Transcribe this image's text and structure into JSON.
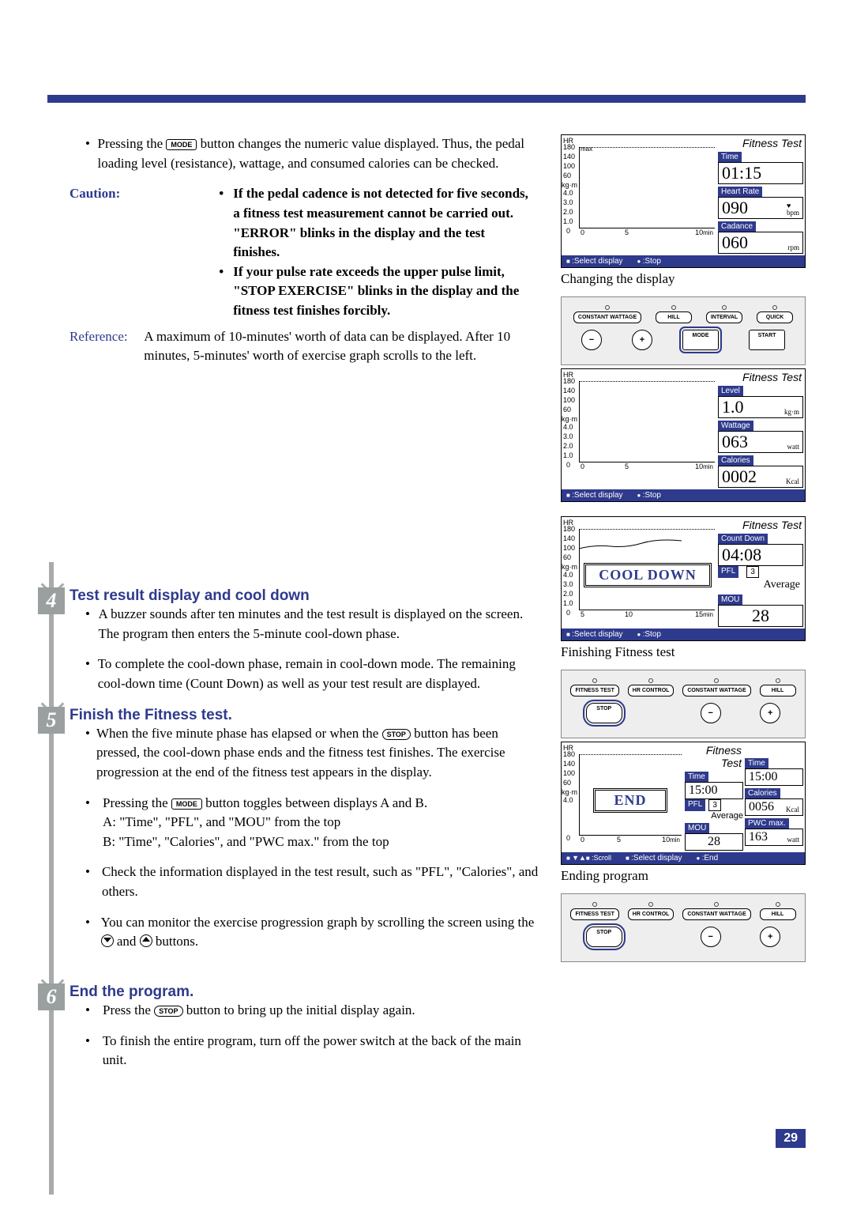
{
  "top": {
    "p1a": "Pressing the ",
    "p1b": " button changes the numeric value displayed. Thus, the pedal loading level (resistance), wattage, and consumed calories can be checked.",
    "cautionLabel": "Caution:",
    "c1": "If the pedal cadence is not detected for five seconds, a fitness test measurement cannot be carried out. \"ERROR\" blinks in the display and the test finishes.",
    "c2": "If your pulse rate exceeds the upper pulse limit, \"STOP EXERCISE\" blinks in the display and the fitness test finishes forcibly.",
    "refLabel": "Reference:",
    "ref": "A maximum of 10-minutes' worth of data can be displayed. After 10 minutes, 5-minutes' worth of exercise graph scrolls to the left."
  },
  "s4": {
    "num": "4",
    "title": "Test result display and cool down",
    "b1": "A buzzer sounds after ten minutes and the test result is displayed on the screen. The program then enters the 5-minute cool-down phase.",
    "b2": "To complete the cool-down phase, remain in cool-down mode. The remaining cool-down time (Count Down) as well as your test result are displayed."
  },
  "s5": {
    "num": "5",
    "title": "Finish the Fitness test.",
    "b1a": "When the five minute phase has elapsed or when the ",
    "b1b": " button has been pressed, the cool-down phase ends and the fitness test finishes. The exercise progression at the end of the fitness test appears in the display.",
    "b2a": "Pressing the ",
    "b2b": " button toggles between displays A and B.",
    "b2c": "A: \"Time\", \"PFL\", and \"MOU\" from the top",
    "b2d": "B: \"Time\", \"Calories\", and \"PWC max.\" from the top",
    "b3": "Check the information displayed in the test result, such as \"PFL\", \"Calories\", and others.",
    "b4a": "You can monitor the exercise progression graph by scrolling the screen using the ",
    "b4b": " and ",
    "b4c": " buttons."
  },
  "s6": {
    "num": "6",
    "title": "End the program.",
    "b1a": "Press the ",
    "b1b": " button to bring up the initial display again.",
    "b2": "To finish the entire program, turn off the power switch at the back of the main unit."
  },
  "btns": {
    "mode": "MODE",
    "stop": "STOP"
  },
  "disp": {
    "ft": "Fitness Test",
    "hr": "HR",
    "max": "max",
    "kgm": "kg·m",
    "y": [
      "180",
      "140",
      "100",
      "60",
      "4.0",
      "3.0",
      "2.0",
      "1.0",
      "0"
    ],
    "x": [
      "0",
      "5",
      "10"
    ],
    "xmin": "min",
    "selDisp": ":Select display",
    "stop": ":Stop",
    "end": ":End",
    "scroll": ":Scroll",
    "panel1": {
      "time": "Time",
      "timeV": "01:15",
      "hrL": "Heart Rate",
      "hrV": "090",
      "hrU": "bpm",
      "cad": "Cadance",
      "cadV": "060",
      "cadU": "rpm"
    },
    "cap1": "Changing the display",
    "kp1": [
      "CONSTANT WATTAGE",
      "HILL",
      "INTERVAL",
      "QUICK"
    ],
    "kp1b": [
      "−",
      "+",
      "MODE",
      "START"
    ],
    "panel2": {
      "lvl": "Level",
      "lvlV": "1.0",
      "lvlU": "kg·m",
      "wat": "Wattage",
      "watV": "063",
      "watU": "watt",
      "cal": "Calories",
      "calV": "0002",
      "calU": "Kcal"
    },
    "panel3": {
      "cool": "COOL DOWN",
      "cd": "Count Down",
      "cdV": "04:08",
      "pfl": "PFL",
      "pflV": "3",
      "avg": "Average",
      "mou": "MOU",
      "mouV": "28",
      "x": [
        "5",
        "10",
        "15"
      ]
    },
    "cap3": "Finishing Fitness test",
    "kp2": [
      "FITNESS TEST",
      "HR CONTROL",
      "CONSTANT WATTAGE",
      "HILL"
    ],
    "panel4": {
      "end": "END",
      "time": "Time",
      "timeV": "15:00",
      "cal": "Calories",
      "calV": "0056",
      "calU": "Kcal",
      "pfl": "PFL",
      "pflV": "3",
      "avg": "Average",
      "mou": "MOU",
      "mouV": "28",
      "pwc": "PWC max.",
      "pwcV": "163",
      "pwcU": "watt"
    },
    "cap4": "Ending program"
  },
  "page": "29"
}
